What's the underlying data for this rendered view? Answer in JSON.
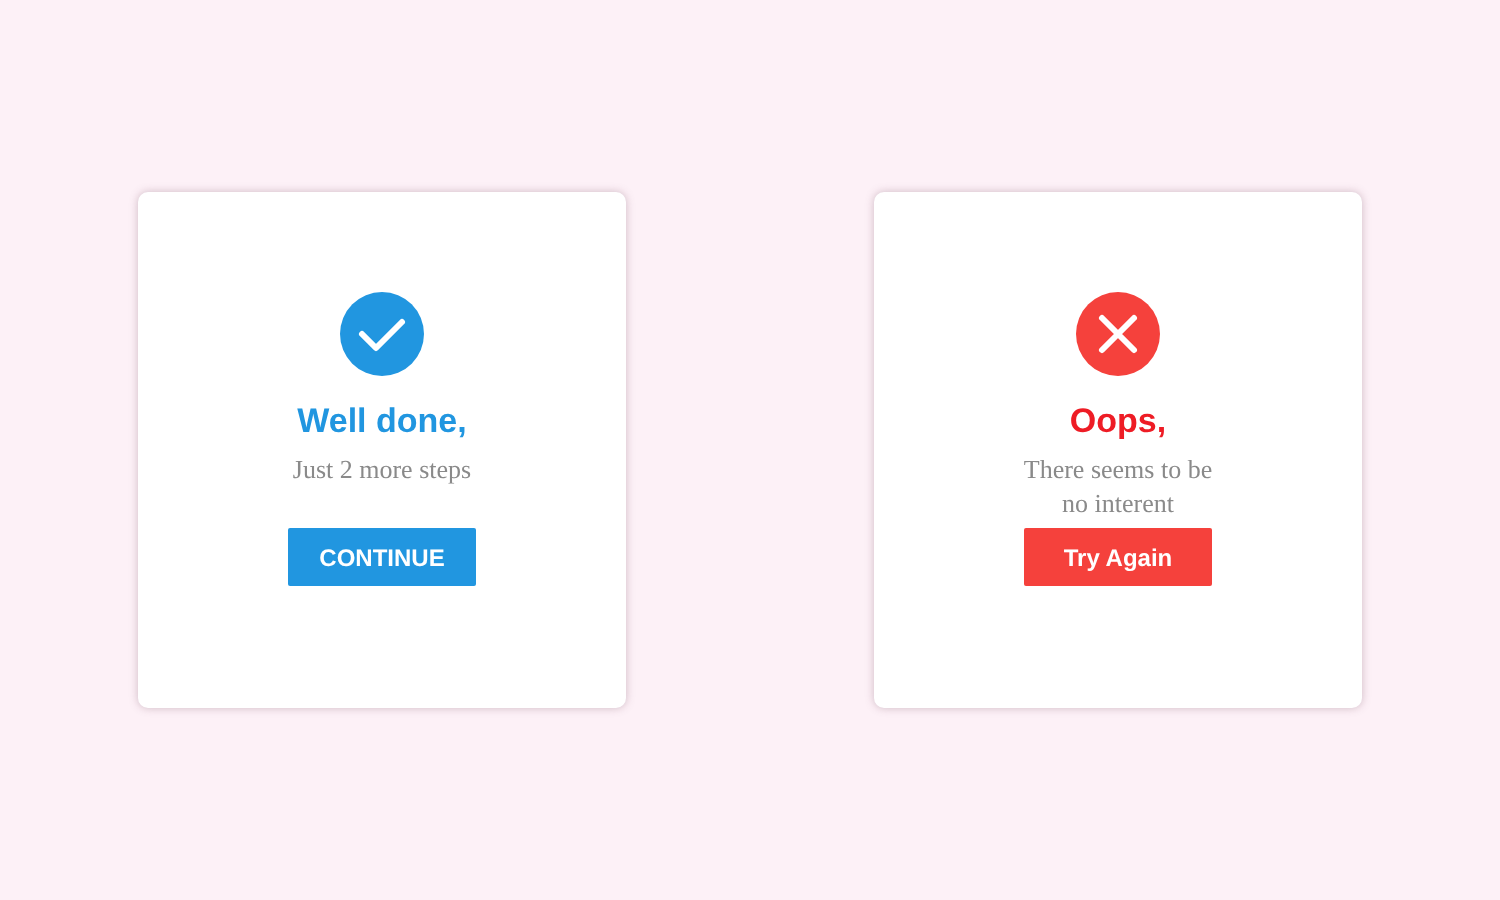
{
  "cards": [
    {
      "kind": "success",
      "title": "Well done,",
      "message": "Just 2 more steps",
      "button": "CONTINUE"
    },
    {
      "kind": "error",
      "title": "Oops,",
      "message": "There seems to be\nno interent",
      "button": "Try Again"
    }
  ]
}
